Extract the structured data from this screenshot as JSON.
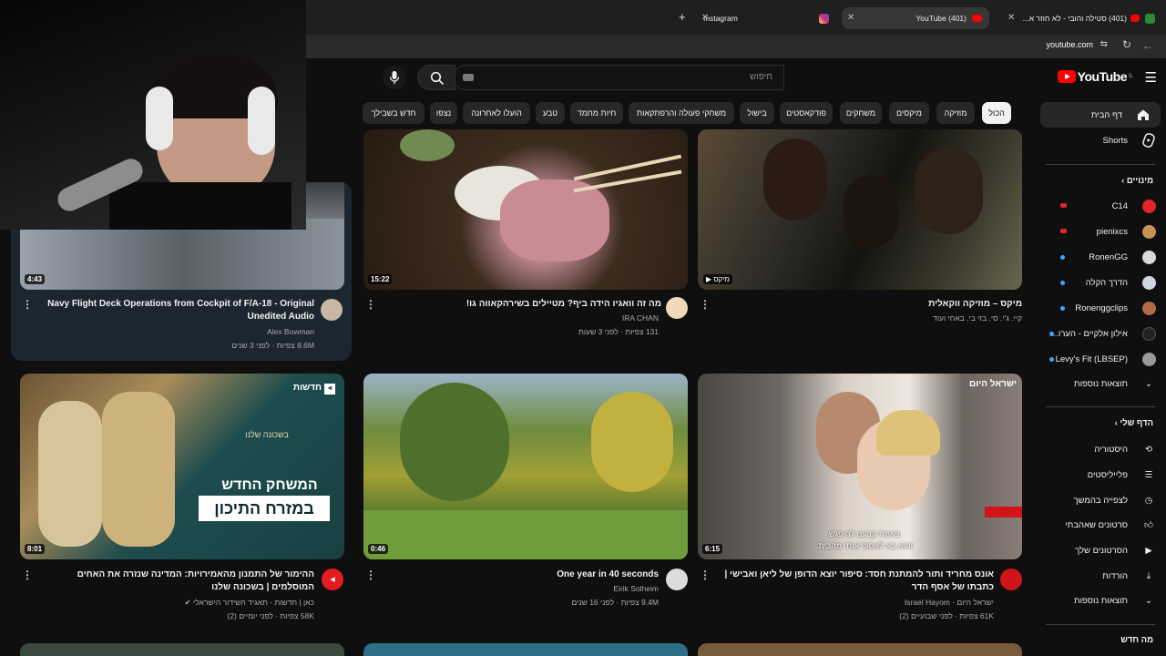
{
  "browser": {
    "tabs": [
      {
        "title": "(401) סטילה והובי - לא חוזר א..."
      },
      {
        "title": "(401) YouTube"
      },
      {
        "title": "Instagram"
      }
    ],
    "new_tab": "+",
    "url": "youtube.com"
  },
  "header": {
    "logo": "YouTube",
    "logo_sup": "IL",
    "search_placeholder": "חיפוש"
  },
  "chips": [
    {
      "label": "הכול",
      "active": true
    },
    {
      "label": "מוזיקה"
    },
    {
      "label": "מיקסים"
    },
    {
      "label": "משחקים"
    },
    {
      "label": "פודקאסטים"
    },
    {
      "label": "בישול"
    },
    {
      "label": "משחקי פעולה והרפתקאות"
    },
    {
      "label": "חיות מחמד"
    },
    {
      "label": "טבע"
    },
    {
      "label": "הועלו לאחרונה"
    },
    {
      "label": "נצפו"
    },
    {
      "label": "חדש בשבילך"
    }
  ],
  "sidebar": {
    "home": "דף הבית",
    "shorts": "Shorts",
    "subscriptions_title": "מינויים",
    "subscriptions": [
      {
        "name": "C14",
        "color": "#e0262a"
      },
      {
        "name": "pienixcs",
        "color": "#c8915a"
      },
      {
        "name": "RonenGG",
        "color": "#d8d8d8"
      },
      {
        "name": "הדרך הקלה",
        "color": "#cfd6e0"
      },
      {
        "name": "Ronenggclips",
        "color": "#b46a48"
      },
      {
        "name": "אילון אלקיים - הערו...",
        "color": "#222222"
      },
      {
        "name": "Levy's Fit (LBSEP)",
        "color": "#9a9a9a"
      }
    ],
    "subs_more": "תוצאות נוספות",
    "you_title": "הדף שלי",
    "you_items": [
      {
        "label": "היסטוריה",
        "icon": "history-icon"
      },
      {
        "label": "פלייליסטים",
        "icon": "playlists-icon"
      },
      {
        "label": "לצפייה בהמשך",
        "icon": "watch-later-icon"
      },
      {
        "label": "סרטונים שאהבתי",
        "icon": "liked-icon"
      },
      {
        "label": "הסרטונים שלך",
        "icon": "your-videos-icon"
      },
      {
        "label": "הורדות",
        "icon": "downloads-icon"
      },
      {
        "label": "תוצאות נוספות",
        "icon": "chevron-down-icon"
      }
    ],
    "whats_new": "מה חדש"
  },
  "videos": [
    {
      "title": "מיקס – מוזיקה ווקאלית",
      "meta1": "קיי. ג'י. סי, בזי בי, באחי ועוד",
      "badge": "מיקס"
    },
    {
      "title": "מה זה וואגיו הידה ביף? מטיילים בשירהקאווה גו!",
      "channel": "IRA CHAN",
      "stats": "131 צפיות · לפני 3 שעות",
      "duration": "15:22"
    },
    {
      "title": "Navy Flight Deck Operations from Cockpit of F/A-18 - Original Unedited Audio",
      "channel": "Alex Bowman",
      "stats": "8.6M צפיות · לפני 3 שנים",
      "duration": "4:43"
    },
    {
      "title": "אונס מחריד ותור להמתנת חסד: סיפור יוצא הדופן של ליאן ואבישי | כתבתו של אסף הדר",
      "channel": "ישראל היום · Israel Hayom",
      "stats": "61K צפיות · לפני שבועיים (2)",
      "duration": "6:15",
      "overlay": "ישראל היום",
      "caption1": "באמת קבענו להיפגש",
      "caption2": "והוא בא לאסוף אותי מהבית."
    },
    {
      "title": "One year in 40 seconds",
      "channel": "Eirik Solheim",
      "stats": "9.4M צפיות · לפני 16 שנים",
      "duration": "0:46"
    },
    {
      "title": "ההימור של התמנון מהאמירויות: המדינה שנזרה את האחים המוסלמים | בשכונה שלנו",
      "channel": "כאן | חדשות - תאגיד השידור הישראלי",
      "stats": "58K צפיות · לפני יומיים (2)",
      "duration": "8:01",
      "overlay": "חדשות",
      "thumb_line1": "המשחק החדש",
      "thumb_line2": "במזרח התיכון",
      "thumb_logo": "בשכונה שלנו"
    }
  ],
  "colors": {
    "accent": "#ff0000",
    "bg": "#0f0f0f",
    "chip": "#272727"
  }
}
